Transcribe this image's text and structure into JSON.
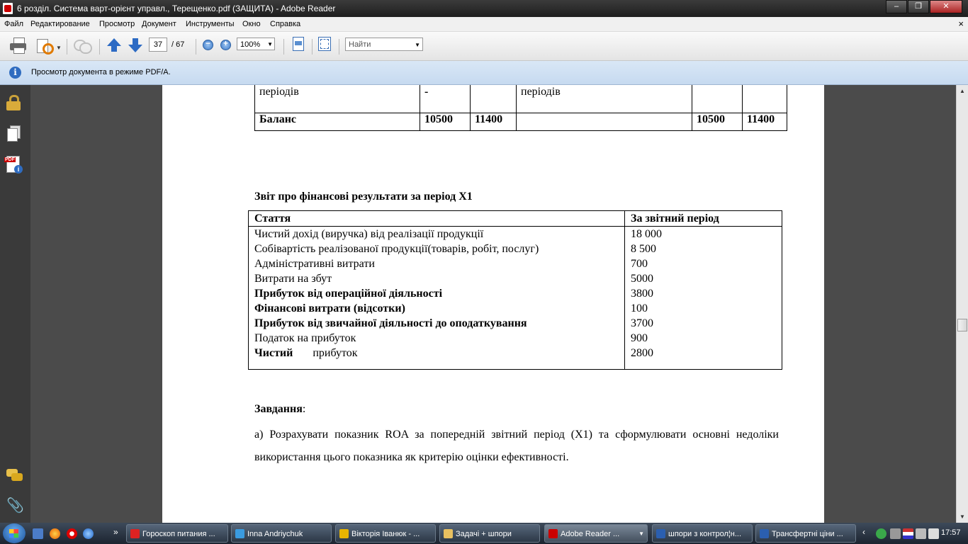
{
  "window": {
    "title": "6 розділ. Система варт-орієнт управл., Терещенко.pdf (ЗАЩИТА) - Adobe Reader",
    "controls": [
      "–",
      "❐",
      "✕"
    ]
  },
  "menu": {
    "items": [
      "Файл",
      "Редактирование",
      "Просмотр",
      "Документ",
      "Инструменты",
      "Окно",
      "Справка"
    ],
    "close": "×"
  },
  "toolbar": {
    "page_current": "37",
    "page_total": "/ 67",
    "zoom_out": "−",
    "zoom_in": "+",
    "zoom_value": "100%",
    "find_placeholder": "Найти"
  },
  "infobar": {
    "text": "Просмотр документа в режиме PDF/A."
  },
  "document": {
    "balance_fragment": {
      "row1": [
        "періодів",
        "-",
        "",
        "періодів",
        "",
        ""
      ],
      "row2": [
        "Баланс",
        "10500",
        "11400",
        "",
        "10500",
        "11400"
      ]
    },
    "report_title": "Звіт про фінансові результати за період Х1",
    "report_headers": [
      "Стаття",
      "За звітний період"
    ],
    "report_rows": [
      {
        "item": "Чистий дохід (виручка) від  реалізації продукції",
        "value": "18 000",
        "bold": false
      },
      {
        "item": "Собівартість реалізованої  продукції(товарів, робіт, послуг)",
        "value": "8 500",
        "bold": false
      },
      {
        "item": "Адміністративні витрати",
        "value": "700",
        "bold": false
      },
      {
        "item": "Витрати на збут",
        "value": "5000",
        "bold": false
      },
      {
        "item": "Прибуток від операційної діяльності",
        "value": "3800",
        "bold": true
      },
      {
        "item": "Фінансові витрати (відсотки)",
        "value": "100",
        "bold": true
      },
      {
        "item": "Прибуток від звичайної діяльності до оподаткування",
        "value": "3700",
        "bold": true
      },
      {
        "item": "Податок на прибуток",
        "value": "900",
        "bold": false
      }
    ],
    "net_profit": {
      "label_bold": "Чистий",
      "label_rest": "прибуток",
      "value": "2800"
    },
    "task_heading": "Завдання",
    "task_colon": ":",
    "task_text": "а) Розрахувати показник ROA за попередній звітний період (Х1) та сформулювати основні недоліки використання цього показника як критерію оцінки ефективності."
  },
  "taskbar": {
    "buttons": [
      {
        "label": "Гороскоп питания ...",
        "color": "#d22"
      },
      {
        "label": "Inna Andriychuk",
        "color": "#3a9be0"
      },
      {
        "label": "Вікторія Іванюк - ...",
        "color": "#e8b400"
      },
      {
        "label": "Задачі + шпори",
        "color": "#e8c060"
      },
      {
        "label": "Adobe Reader ...",
        "color": "#c00"
      },
      {
        "label": "шпори з контрол¦н...",
        "color": "#2b5fb0"
      },
      {
        "label": "Трансфертні ціни ...",
        "color": "#2b5fb0"
      }
    ],
    "overflow": "‹",
    "show_more": "›",
    "clock": "17:57"
  }
}
